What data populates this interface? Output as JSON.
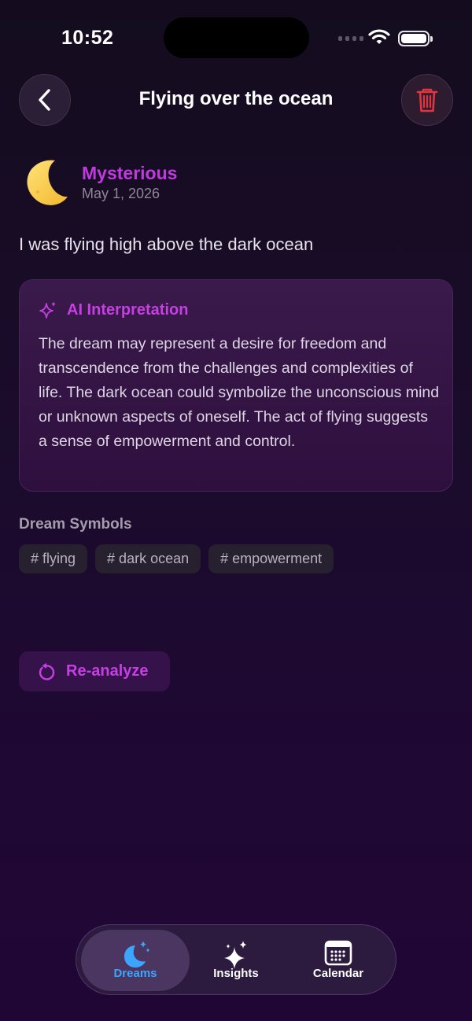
{
  "status_bar": {
    "time": "10:52"
  },
  "header": {
    "title": "Flying over the ocean"
  },
  "mood": {
    "emoji": "crescent-moon",
    "label": "Mysterious",
    "date": "May 1, 2026"
  },
  "dream": {
    "text": "I was flying high above the dark ocean"
  },
  "interpretation": {
    "title": "AI Interpretation",
    "body": "The dream may represent a desire for freedom and transcendence from the challenges and complexities of life. The dark ocean could symbolize the unconscious mind or unknown aspects of oneself. The act of flying suggests a sense of empowerment and control."
  },
  "symbols": {
    "title": "Dream Symbols",
    "items": [
      "# flying",
      "# dark ocean",
      "# empowerment"
    ]
  },
  "reanalyze": {
    "label": "Re-analyze"
  },
  "tab_bar": {
    "tabs": [
      {
        "label": "Dreams",
        "icon": "moon-stars-icon",
        "active": true
      },
      {
        "label": "Insights",
        "icon": "sparkles-icon",
        "active": false
      },
      {
        "label": "Calendar",
        "icon": "calendar-icon",
        "active": false
      }
    ]
  },
  "colors": {
    "accent": "#c53fe2",
    "active_tab": "#3ba5ff",
    "delete": "#e0353f"
  }
}
